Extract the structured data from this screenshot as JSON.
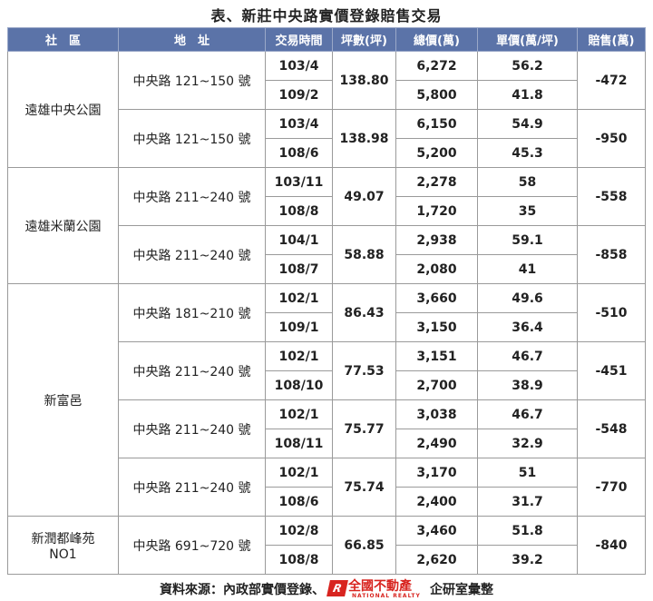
{
  "title": "表、新莊中央路實價登錄賠售交易",
  "headers": [
    "社　區",
    "地　址",
    "交易時間",
    "坪數(坪)",
    "總價(萬)",
    "單價(萬/坪)",
    "賠售(萬)"
  ],
  "communities": [
    {
      "name": "遠雄中央公園",
      "groups": [
        {
          "address": "中央路 121~150 號",
          "area": "138.80",
          "loss": "-472",
          "trades": [
            {
              "date": "103/4",
              "total": "6,272",
              "unit": "56.2"
            },
            {
              "date": "109/2",
              "total": "5,800",
              "unit": "41.8"
            }
          ]
        },
        {
          "address": "中央路 121~150 號",
          "area": "138.98",
          "loss": "-950",
          "trades": [
            {
              "date": "103/4",
              "total": "6,150",
              "unit": "54.9"
            },
            {
              "date": "108/6",
              "total": "5,200",
              "unit": "45.3"
            }
          ]
        }
      ]
    },
    {
      "name": "遠雄米蘭公園",
      "groups": [
        {
          "address": "中央路 211~240 號",
          "area": "49.07",
          "loss": "-558",
          "trades": [
            {
              "date": "103/11",
              "total": "2,278",
              "unit": "58"
            },
            {
              "date": "108/8",
              "total": "1,720",
              "unit": "35"
            }
          ]
        },
        {
          "address": "中央路 211~240 號",
          "area": "58.88",
          "loss": "-858",
          "trades": [
            {
              "date": "104/1",
              "total": "2,938",
              "unit": "59.1"
            },
            {
              "date": "108/7",
              "total": "2,080",
              "unit": "41"
            }
          ]
        }
      ]
    },
    {
      "name": "新富邑",
      "groups": [
        {
          "address": "中央路 181~210 號",
          "area": "86.43",
          "loss": "-510",
          "trades": [
            {
              "date": "102/1",
              "total": "3,660",
              "unit": "49.6"
            },
            {
              "date": "109/1",
              "total": "3,150",
              "unit": "36.4"
            }
          ]
        },
        {
          "address": "中央路 211~240 號",
          "area": "77.53",
          "loss": "-451",
          "trades": [
            {
              "date": "102/1",
              "total": "3,151",
              "unit": "46.7"
            },
            {
              "date": "108/10",
              "total": "2,700",
              "unit": "38.9"
            }
          ]
        },
        {
          "address": "中央路 211~240 號",
          "area": "75.77",
          "loss": "-548",
          "trades": [
            {
              "date": "102/1",
              "total": "3,038",
              "unit": "46.7"
            },
            {
              "date": "108/11",
              "total": "2,490",
              "unit": "32.9"
            }
          ]
        },
        {
          "address": "中央路 211~240 號",
          "area": "75.74",
          "loss": "-770",
          "trades": [
            {
              "date": "102/1",
              "total": "3,170",
              "unit": "51"
            },
            {
              "date": "108/6",
              "total": "2,400",
              "unit": "31.7"
            }
          ]
        }
      ]
    },
    {
      "name": "新潤都峰苑\nNO1",
      "groups": [
        {
          "address": "中央路 691~720 號",
          "area": "66.85",
          "loss": "-840",
          "trades": [
            {
              "date": "102/8",
              "total": "3,460",
              "unit": "51.8"
            },
            {
              "date": "108/8",
              "total": "2,620",
              "unit": "39.2"
            }
          ]
        }
      ]
    }
  ],
  "footer": {
    "prefix": "資料來源：內政部實價登錄、",
    "logo_brand": "全國不動產",
    "logo_sub": "NATIONAL REALTY",
    "logo_mark": "R",
    "suffix": "企研室彙整"
  },
  "colors": {
    "header_bg": "#5b73a8",
    "logo_red": "#d8241f"
  }
}
